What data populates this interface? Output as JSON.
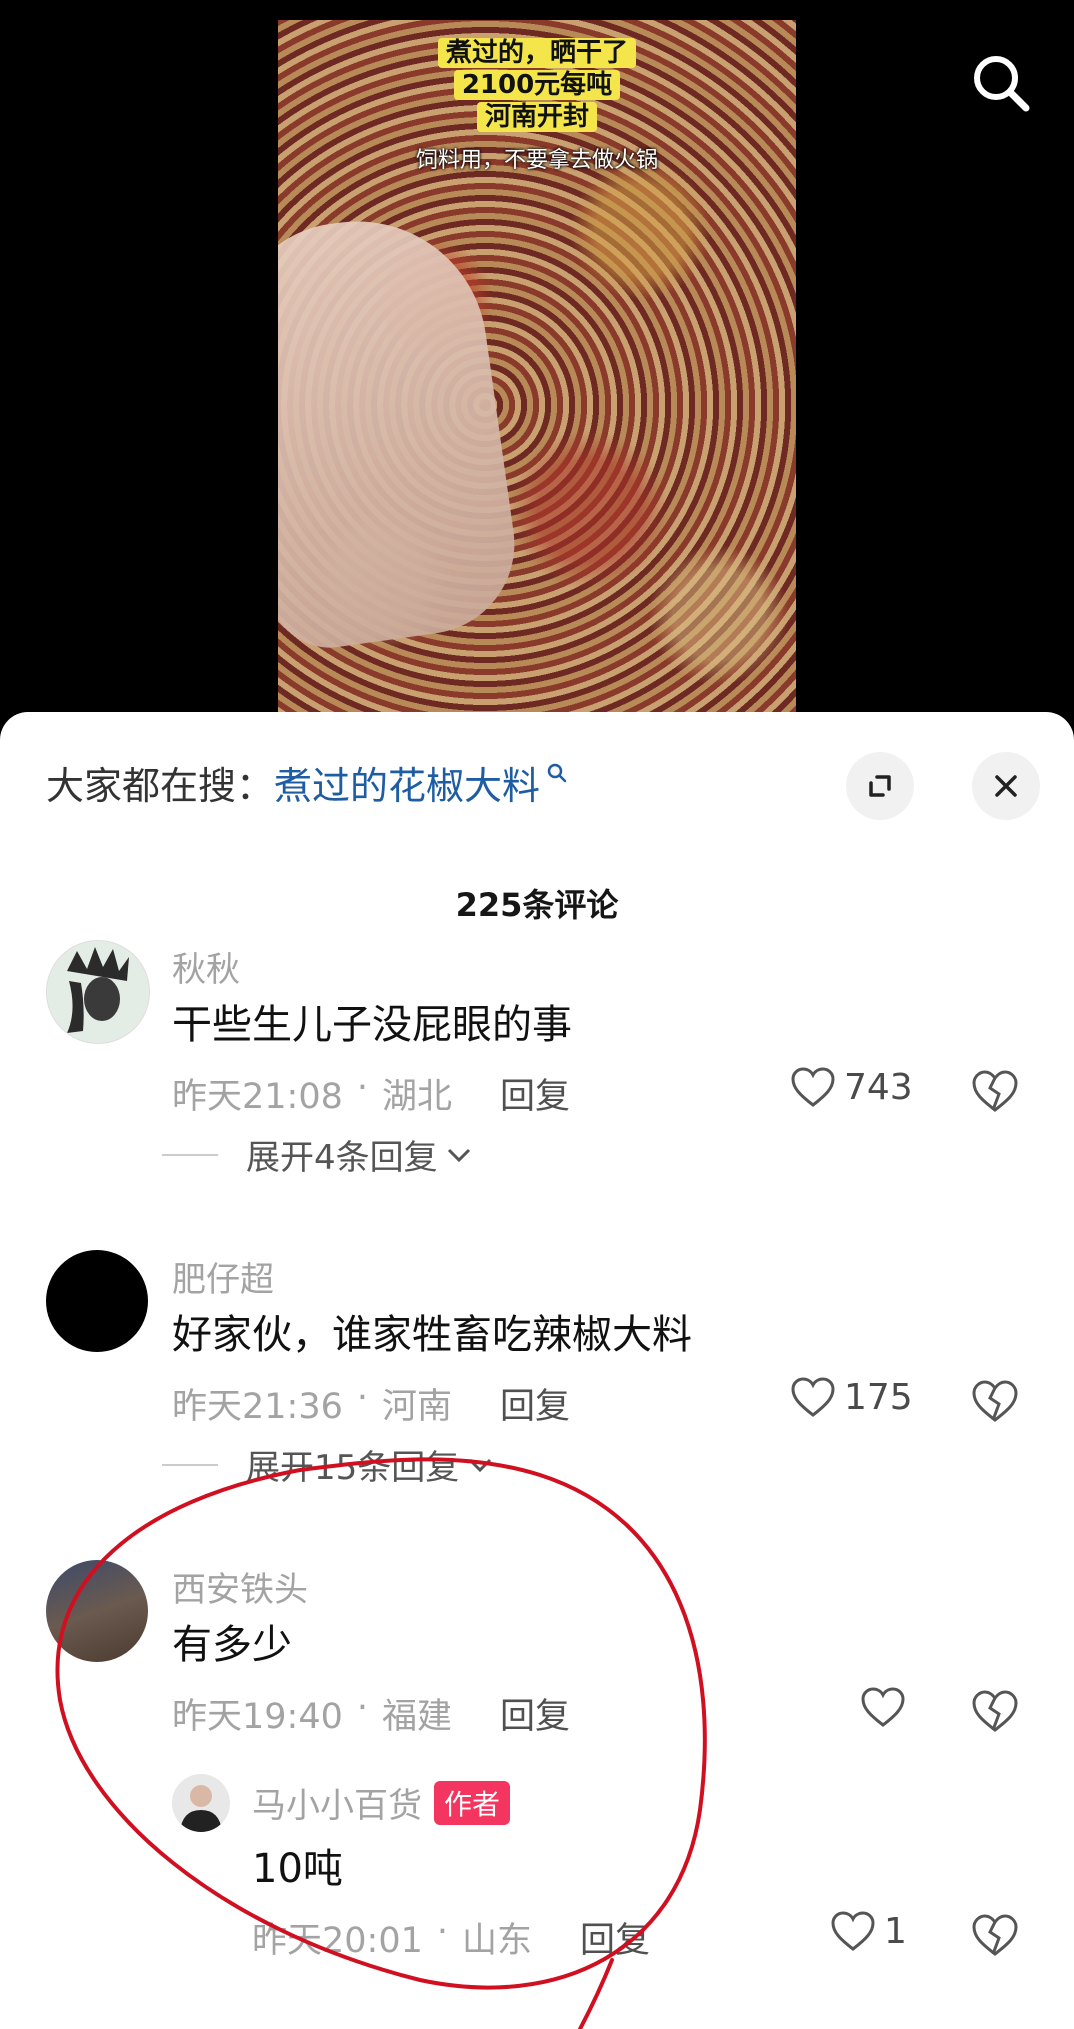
{
  "video": {
    "captions": [
      "煮过的，晒干了",
      "2100元每吨",
      "河南开封",
      "饲料用，不要拿去做火锅"
    ]
  },
  "hot_search": {
    "label": "大家都在搜：",
    "term": "煮过的花椒大料"
  },
  "comment_count": "225条评论",
  "comments": [
    {
      "user": "秋秋",
      "text": "干些生儿子没屁眼的事",
      "time": "昨天21:08",
      "location": "湖北",
      "reply_label": "回复",
      "likes": "743",
      "expand": "展开4条回复"
    },
    {
      "user": "肥仔超",
      "text": "好家伙，谁家牲畜吃辣椒大料",
      "time": "昨天21:36",
      "location": "河南",
      "reply_label": "回复",
      "likes": "175",
      "expand": "展开15条回复"
    },
    {
      "user": "西安铁头",
      "text": "有多少",
      "time": "昨天19:40",
      "location": "福建",
      "reply_label": "回复",
      "likes": "",
      "reply": {
        "user": "马小小百货",
        "badge": "作者",
        "text": "10吨",
        "time": "昨天20:01",
        "location": "山东",
        "reply_label": "回复",
        "likes": "1"
      }
    }
  ],
  "separator": "·",
  "colors": {
    "link_blue": "#1f5da3",
    "author_badge": "#f4355f",
    "annotation_red": "#d01020"
  }
}
